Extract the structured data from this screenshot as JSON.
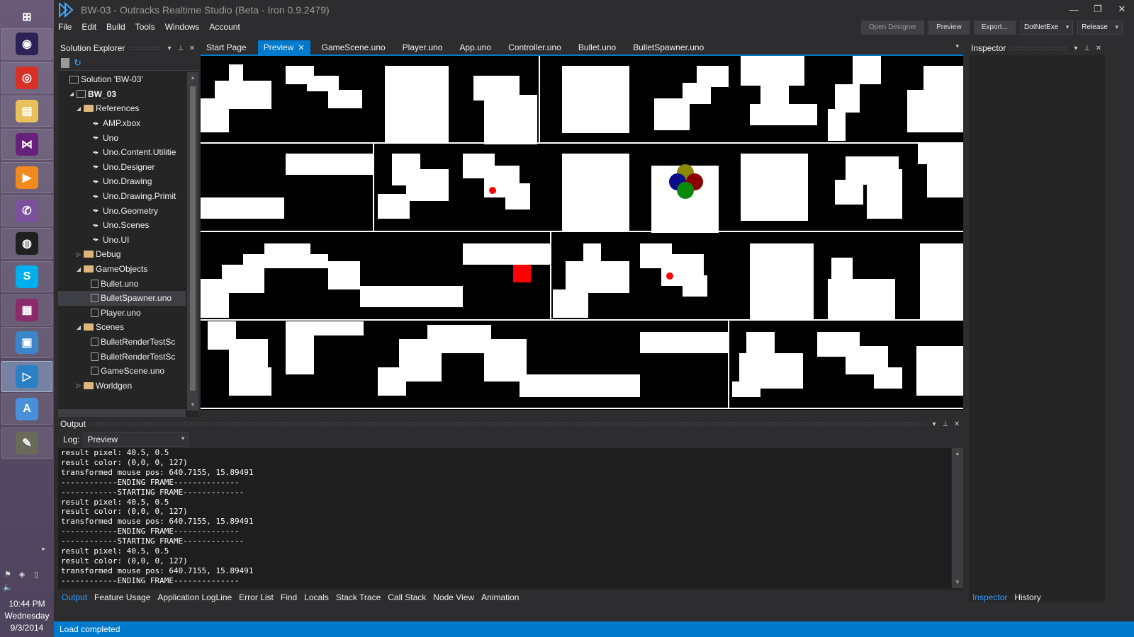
{
  "window": {
    "title": "BW-03 - Outracks Realtime Studio (Beta - Iron 0.9.2479)",
    "controls": [
      "—",
      "❐",
      "✕"
    ]
  },
  "menu": [
    "File",
    "Edit",
    "Build",
    "Tools",
    "Windows",
    "Account"
  ],
  "toolbar": {
    "open_designer": "Open Designer",
    "preview": "Preview",
    "export": "Export...",
    "target": "DotNetExe",
    "config": "Release"
  },
  "taskbar": {
    "apps": [
      {
        "icon": "windows-start-icon",
        "label": "⊞",
        "color": "transparent"
      },
      {
        "icon": "eclipse-icon",
        "label": "◉",
        "color": "#2c2255"
      },
      {
        "icon": "chrome-icon",
        "label": "◎",
        "color": "#d93025"
      },
      {
        "icon": "file-explorer-icon",
        "label": "▤",
        "color": "#e8c15a"
      },
      {
        "icon": "visual-studio-icon",
        "label": "⋈",
        "color": "#68217a"
      },
      {
        "icon": "media-player-icon",
        "label": "▶",
        "color": "#f08a1d"
      },
      {
        "icon": "viber-icon",
        "label": "✆",
        "color": "#7b519d"
      },
      {
        "icon": "obs-icon",
        "label": "◍",
        "color": "#202020"
      },
      {
        "icon": "skype-icon",
        "label": "S",
        "color": "#00aff0"
      },
      {
        "icon": "winrar-icon",
        "label": "▦",
        "color": "#8b2b6b"
      },
      {
        "icon": "photo-viewer-icon",
        "label": "▣",
        "color": "#3a86c8"
      },
      {
        "icon": "outracks-icon",
        "label": "▷",
        "color": "#2b7fc4"
      },
      {
        "icon": "font-viewer-icon",
        "label": "A",
        "color": "#4a90d9"
      },
      {
        "icon": "gimp-icon",
        "label": "✎",
        "color": "#6a6a5a"
      }
    ],
    "clock": {
      "time": "10:44 PM",
      "day": "Wednesday",
      "date": "9/3/2014"
    }
  },
  "solution_explorer": {
    "title": "Solution Explorer",
    "items": [
      {
        "label": "Solution 'BW-03'",
        "indent": 0,
        "expander": "",
        "icon": "solution"
      },
      {
        "label": "BW_03",
        "indent": 1,
        "expander": "◢",
        "icon": "project",
        "bold": true
      },
      {
        "label": "References",
        "indent": 2,
        "expander": "◢",
        "icon": "references"
      },
      {
        "label": "AMP.xbox",
        "indent": 3,
        "expander": "",
        "icon": "reference"
      },
      {
        "label": "Uno",
        "indent": 3,
        "expander": "",
        "icon": "reference"
      },
      {
        "label": "Uno.Content.Utilitie",
        "indent": 3,
        "expander": "",
        "icon": "reference"
      },
      {
        "label": "Uno.Designer",
        "indent": 3,
        "expander": "",
        "icon": "reference"
      },
      {
        "label": "Uno.Drawing",
        "indent": 3,
        "expander": "",
        "icon": "reference"
      },
      {
        "label": "Uno.Drawing.Primit",
        "indent": 3,
        "expander": "",
        "icon": "reference"
      },
      {
        "label": "Uno.Geometry",
        "indent": 3,
        "expander": "",
        "icon": "reference"
      },
      {
        "label": "Uno.Scenes",
        "indent": 3,
        "expander": "",
        "icon": "reference"
      },
      {
        "label": "Uno.UI",
        "indent": 3,
        "expander": "",
        "icon": "reference"
      },
      {
        "label": "Debug",
        "indent": 2,
        "expander": "▷",
        "icon": "folder"
      },
      {
        "label": "GameObjects",
        "indent": 2,
        "expander": "◢",
        "icon": "folder"
      },
      {
        "label": "Bullet.uno",
        "indent": 3,
        "expander": "",
        "icon": "file"
      },
      {
        "label": "BulletSpawner.uno",
        "indent": 3,
        "expander": "",
        "icon": "file",
        "selected": true
      },
      {
        "label": "Player.uno",
        "indent": 3,
        "expander": "",
        "icon": "file"
      },
      {
        "label": "Scenes",
        "indent": 2,
        "expander": "◢",
        "icon": "folder"
      },
      {
        "label": "BulletRenderTestSc",
        "indent": 3,
        "expander": "",
        "icon": "file"
      },
      {
        "label": "BulletRenderTestSc",
        "indent": 3,
        "expander": "",
        "icon": "file"
      },
      {
        "label": "GameScene.uno",
        "indent": 3,
        "expander": "",
        "icon": "file"
      },
      {
        "label": "Worldgen",
        "indent": 2,
        "expander": "▷",
        "icon": "folder"
      }
    ]
  },
  "editor": {
    "tabs": [
      "Start Page",
      "Preview",
      "GameScene.uno",
      "Player.uno",
      "App.uno",
      "Controller.uno",
      "Bullet.uno",
      "BulletSpawner.uno"
    ],
    "active_tab": 1
  },
  "inspector": {
    "title": "Inspector",
    "tabs": [
      "Inspector",
      "History"
    ],
    "active_tab": 0
  },
  "output": {
    "title": "Output",
    "log_label": "Log:",
    "log_value": "Preview",
    "lines": [
      "result pixel: 40.5, 0.5",
      "result color: (0,0, 0, 127)",
      "transformed mouse pos: 640.7155, 15.89491",
      "------------ENDING FRAME--------------",
      "------------STARTING FRAME-------------",
      "result pixel: 40.5, 0.5",
      "result color: (0,0, 0, 127)",
      "transformed mouse pos: 640.7155, 15.89491",
      "------------ENDING FRAME--------------",
      "------------STARTING FRAME-------------",
      "result pixel: 40.5, 0.5",
      "result color: (0,0, 0, 127)",
      "transformed mouse pos: 640.7155, 15.89491",
      "------------ENDING FRAME--------------"
    ],
    "tabs": [
      "Output",
      "Feature Usage",
      "Application LogLine",
      "Error List",
      "Find",
      "Locals",
      "Stack Trace",
      "Call Stack",
      "Node View",
      "Animation"
    ],
    "active_tab": 0
  },
  "status": {
    "text": "Load completed"
  },
  "colors": {
    "accent": "#007acc",
    "bg": "#2d2d30",
    "panel": "#252526"
  }
}
